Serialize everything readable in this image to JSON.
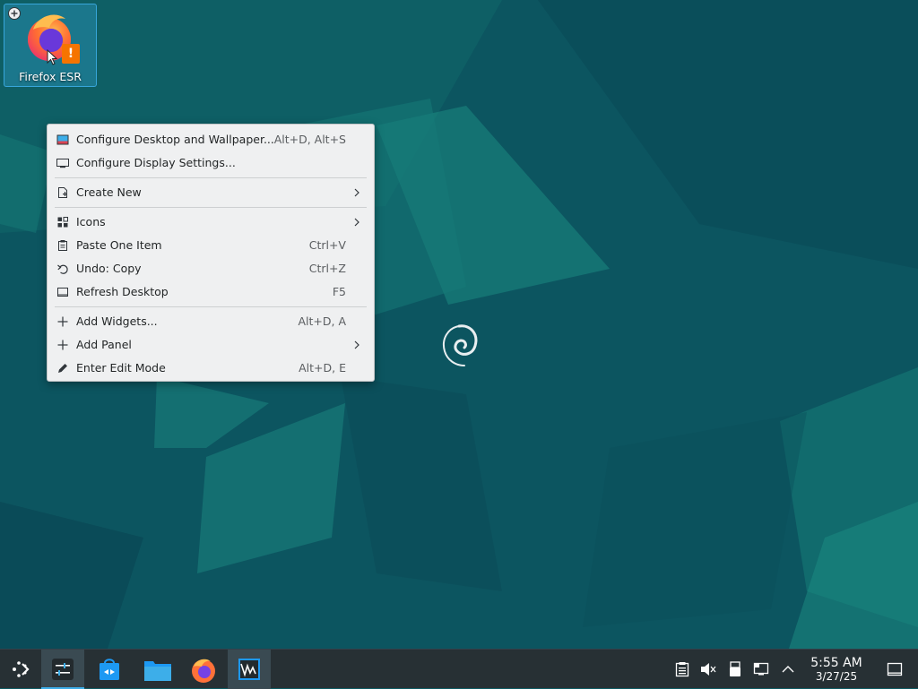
{
  "desktop": {
    "icons": [
      {
        "label": "Firefox ESR",
        "icon": "firefox-icon",
        "badge": "warning-badge",
        "add_overlay": "add-icon"
      }
    ],
    "wallpaper_colors": {
      "base": "#0d5962",
      "light": "#1a8a84",
      "dark": "#07404a"
    }
  },
  "context_menu": {
    "items": [
      {
        "label": "Configure Desktop and Wallpaper...",
        "shortcut": "Alt+D, Alt+S",
        "icon": "wallpaper-icon"
      },
      {
        "label": "Configure Display Settings...",
        "shortcut": "",
        "icon": "display-icon"
      },
      {
        "label": "Create New",
        "shortcut": "",
        "icon": "new-document-icon",
        "submenu": true
      },
      {
        "label": "Icons",
        "shortcut": "",
        "icon": "grid-icon",
        "submenu": true
      },
      {
        "label": "Paste One Item",
        "shortcut": "Ctrl+V",
        "icon": "clipboard-icon"
      },
      {
        "label": "Undo: Copy",
        "shortcut": "Ctrl+Z",
        "icon": "undo-icon"
      },
      {
        "label": "Refresh Desktop",
        "shortcut": "F5",
        "icon": "refresh-icon"
      },
      {
        "label": "Add Widgets...",
        "shortcut": "Alt+D, A",
        "icon": "plus-icon"
      },
      {
        "label": "Add Panel",
        "shortcut": "",
        "icon": "plus-icon",
        "submenu": true
      },
      {
        "label": "Enter Edit Mode",
        "shortcut": "Alt+D, E",
        "icon": "pencil-icon"
      }
    ]
  },
  "taskbar": {
    "apps": [
      {
        "name": "application-launcher",
        "icon": "kde-launcher-icon"
      },
      {
        "name": "pager",
        "icon": "sliders-icon",
        "active": true
      },
      {
        "name": "discover",
        "icon": "software-store-icon"
      },
      {
        "name": "dolphin",
        "icon": "folder-icon"
      },
      {
        "name": "firefox",
        "icon": "firefox-icon"
      },
      {
        "name": "system-monitor",
        "icon": "system-monitor-icon"
      }
    ],
    "tray_icons": [
      "clipboard-icon",
      "volume-muted-icon",
      "usb-device-icon",
      "network-icon",
      "chevron-up-icon"
    ],
    "clock": {
      "time": "5:55 AM",
      "date": "3/27/25"
    },
    "accent_color": "#3daee9",
    "show_desktop_icon": "show-desktop-icon"
  }
}
